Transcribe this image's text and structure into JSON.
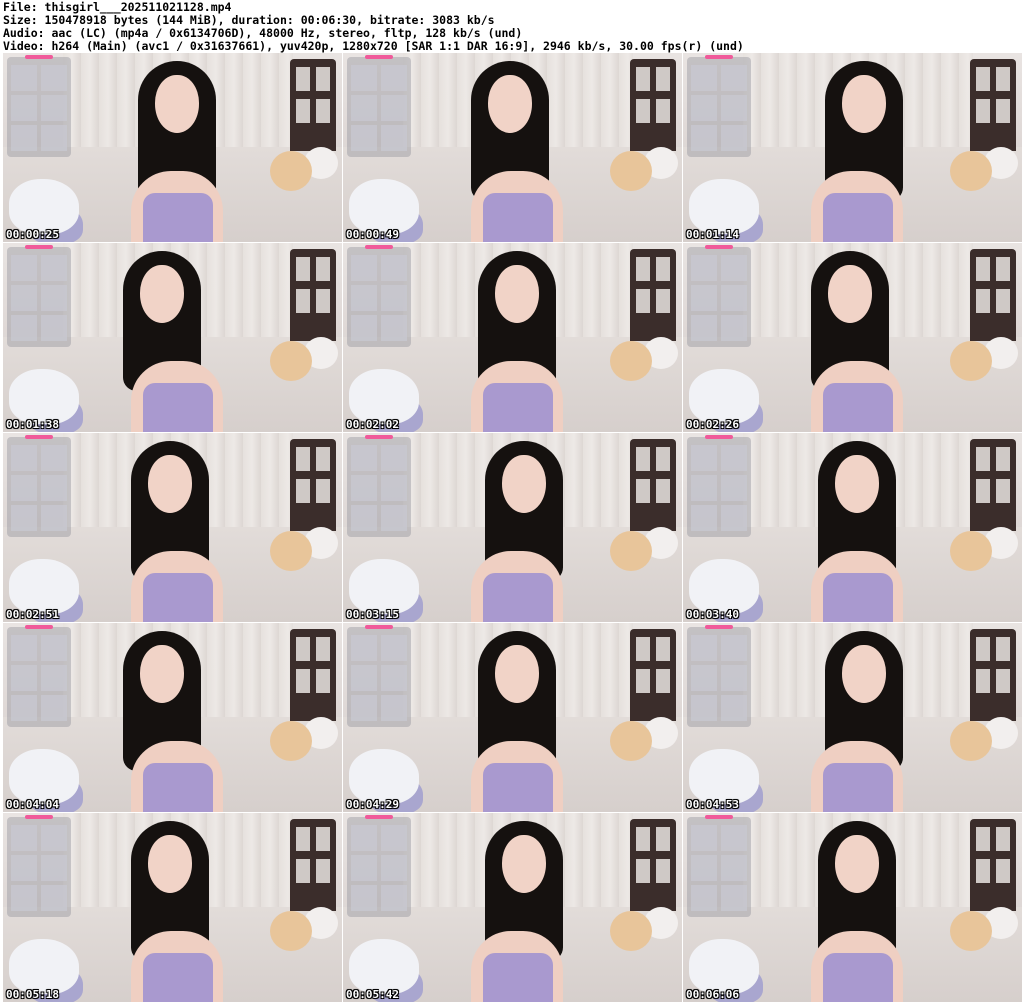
{
  "header": {
    "file_line": "File: thisgirl___202511021128.mp4",
    "size_line": "Size: 150478918 bytes (144 MiB), duration: 00:06:30, bitrate: 3083 kb/s",
    "audio_line": "Audio: aac (LC) (mp4a / 0x6134706D), 48000 Hz, stereo, fltp, 128 kb/s (und)",
    "video_line": "Video: h264 (Main) (avc1 / 0x31637661), yuv420p, 1280x720 [SAR 1:1 DAR 16:9], 2946 kb/s, 30.00 fps(r) (und)"
  },
  "thumbnails": [
    {
      "timestamp": "00:00:25"
    },
    {
      "timestamp": "00:00:49"
    },
    {
      "timestamp": "00:01:14"
    },
    {
      "timestamp": "00:01:38"
    },
    {
      "timestamp": "00:02:02"
    },
    {
      "timestamp": "00:02:26"
    },
    {
      "timestamp": "00:02:51"
    },
    {
      "timestamp": "00:03:15"
    },
    {
      "timestamp": "00:03:40"
    },
    {
      "timestamp": "00:04:04"
    },
    {
      "timestamp": "00:04:29"
    },
    {
      "timestamp": "00:04:53"
    },
    {
      "timestamp": "00:05:18"
    },
    {
      "timestamp": "00:05:42"
    },
    {
      "timestamp": "00:06:06"
    }
  ]
}
